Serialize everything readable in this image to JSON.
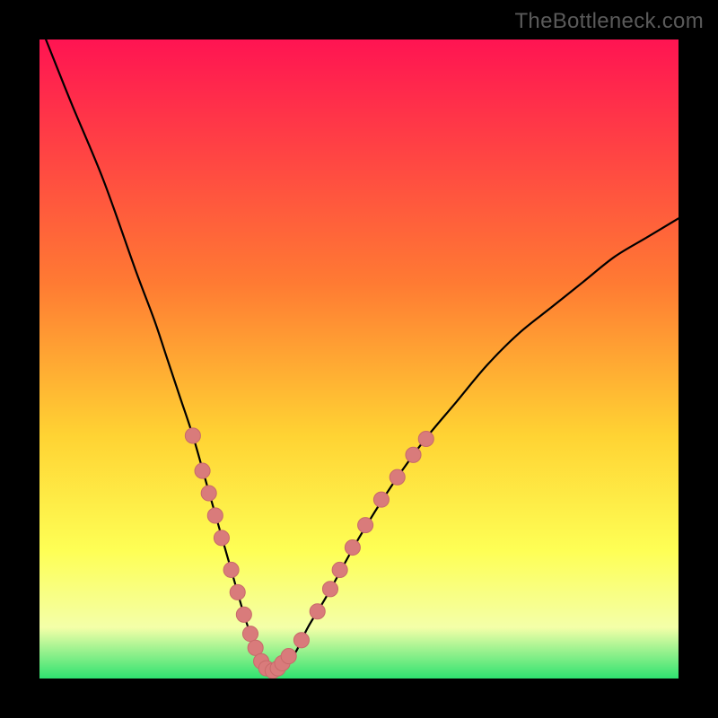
{
  "watermark": "TheBottleneck.com",
  "colors": {
    "bg": "#000000",
    "grad_top": "#ff1452",
    "grad_mid1": "#ff7a33",
    "grad_mid2": "#ffd333",
    "grad_low1": "#feff55",
    "grad_low2": "#f4ffa8",
    "grad_bottom": "#2fe270",
    "curve": "#000000",
    "bead_fill": "#d97b7b",
    "bead_stroke": "#c86a6a"
  },
  "chart_data": {
    "type": "line",
    "title": "",
    "xlabel": "",
    "ylabel": "",
    "xlim": [
      0,
      100
    ],
    "ylim": [
      0,
      100
    ],
    "series": [
      {
        "name": "bottleneck-curve",
        "x": [
          1,
          5,
          10,
          15,
          18,
          20,
          22,
          24,
          26,
          28,
          30,
          32,
          33,
          34,
          35,
          36,
          37,
          38,
          40,
          42,
          45,
          50,
          55,
          60,
          65,
          70,
          75,
          80,
          85,
          90,
          95,
          100
        ],
        "y": [
          100,
          90,
          78,
          64,
          56,
          50,
          44,
          38,
          31,
          24,
          17,
          10,
          7,
          4,
          2,
          1,
          1,
          2,
          4,
          8,
          13,
          22,
          30,
          37,
          43,
          49,
          54,
          58,
          62,
          66,
          69,
          72
        ]
      }
    ],
    "beads": [
      {
        "x": 24.0,
        "y": 38.0
      },
      {
        "x": 25.5,
        "y": 32.5
      },
      {
        "x": 26.5,
        "y": 29.0
      },
      {
        "x": 27.5,
        "y": 25.5
      },
      {
        "x": 28.5,
        "y": 22.0
      },
      {
        "x": 30.0,
        "y": 17.0
      },
      {
        "x": 31.0,
        "y": 13.5
      },
      {
        "x": 32.0,
        "y": 10.0
      },
      {
        "x": 33.0,
        "y": 7.0
      },
      {
        "x": 33.8,
        "y": 4.8
      },
      {
        "x": 34.7,
        "y": 2.7
      },
      {
        "x": 35.5,
        "y": 1.6
      },
      {
        "x": 36.5,
        "y": 1.2
      },
      {
        "x": 37.3,
        "y": 1.6
      },
      {
        "x": 38.0,
        "y": 2.4
      },
      {
        "x": 39.0,
        "y": 3.5
      },
      {
        "x": 41.0,
        "y": 6.0
      },
      {
        "x": 43.5,
        "y": 10.5
      },
      {
        "x": 45.5,
        "y": 14.0
      },
      {
        "x": 47.0,
        "y": 17.0
      },
      {
        "x": 49.0,
        "y": 20.5
      },
      {
        "x": 51.0,
        "y": 24.0
      },
      {
        "x": 53.5,
        "y": 28.0
      },
      {
        "x": 56.0,
        "y": 31.5
      },
      {
        "x": 58.5,
        "y": 35.0
      },
      {
        "x": 60.5,
        "y": 37.5
      }
    ],
    "bead_radius": 1.2
  }
}
